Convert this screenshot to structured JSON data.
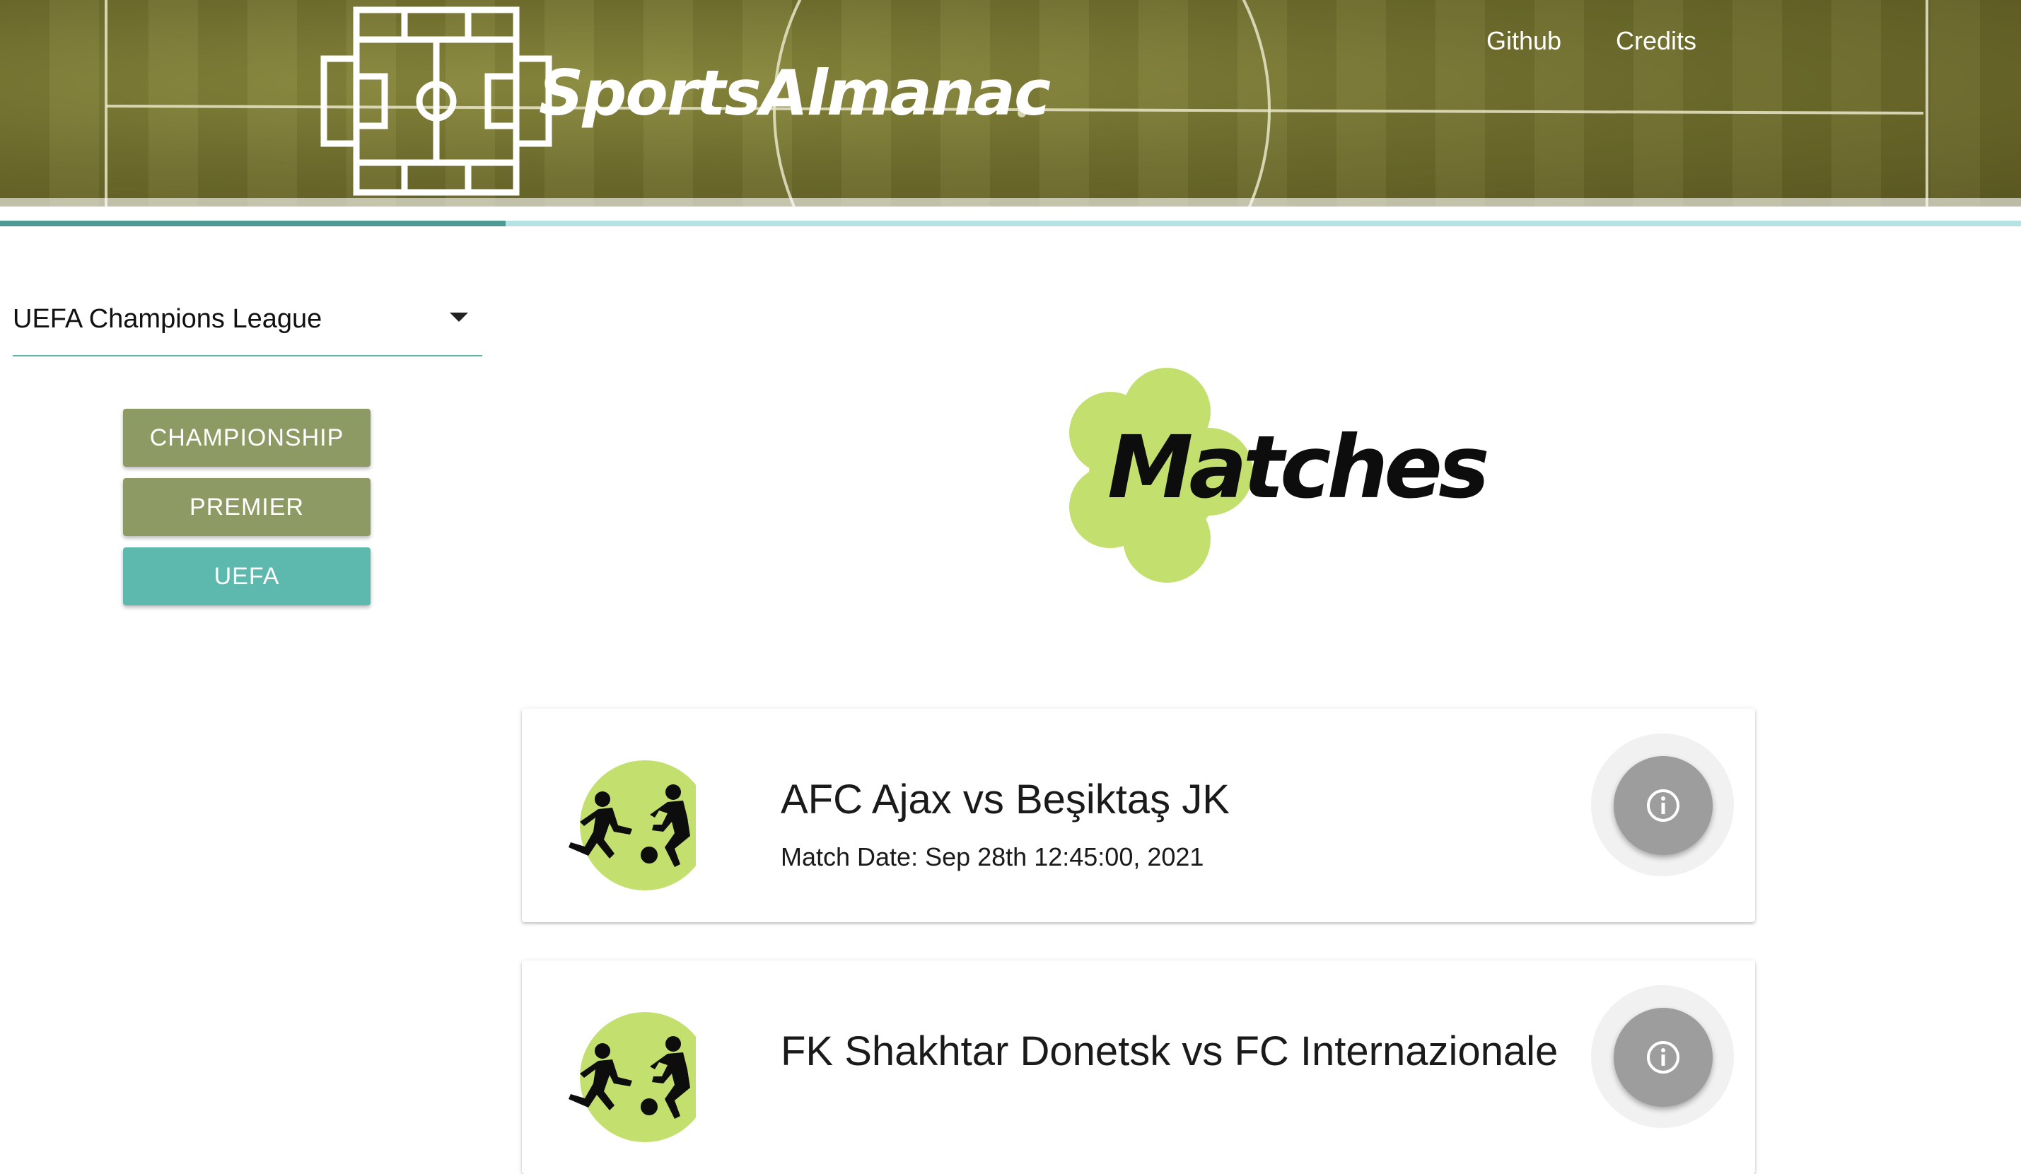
{
  "header": {
    "brand": "SportsAlmanac",
    "logo_icon": "soccer-field-icon",
    "nav": [
      {
        "label": "Github"
      },
      {
        "label": "Credits"
      }
    ]
  },
  "progress": {
    "value_percent": 25
  },
  "sidebar": {
    "league_select": {
      "value": "UEFA Champions League",
      "icon": "chevron-down-icon"
    },
    "buttons": [
      {
        "label": "CHAMPIONSHIP",
        "color": "#8e9a64",
        "active": false
      },
      {
        "label": "PREMIER",
        "color": "#8e9a64",
        "active": false
      },
      {
        "label": "UEFA",
        "color": "#5db8ad",
        "active": true
      }
    ]
  },
  "main": {
    "section_title": "Matches",
    "section_title_bg_color": "#c3e06e",
    "matches": [
      {
        "title": "AFC Ajax vs Beşiktaş JK",
        "date": "Match Date: Sep 28th 12:45:00, 2021",
        "avatar_icon": "soccer-players-icon",
        "action_icon": "info-icon"
      },
      {
        "title": "FK Shakhtar Donetsk vs FC Internazionale",
        "date": "",
        "avatar_icon": "soccer-players-icon",
        "action_icon": "info-icon"
      }
    ]
  },
  "colors": {
    "accent": "#5db8ad",
    "accent_dark": "#4f9a94",
    "accent_light": "#b5e3e3",
    "button_olive": "#8e9a64",
    "lime": "#c3e06e",
    "info_button": "#9d9d9d"
  }
}
